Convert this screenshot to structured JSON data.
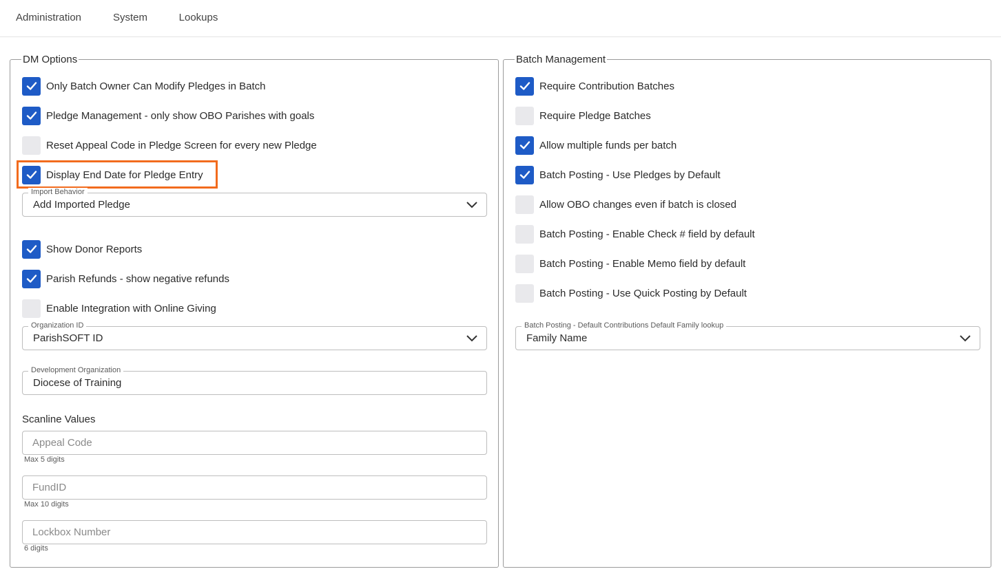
{
  "tabs": [
    {
      "label": "Administration",
      "active": true
    },
    {
      "label": "System",
      "active": false
    },
    {
      "label": "Lookups",
      "active": false
    }
  ],
  "colors": {
    "accent": "#1e5bc6",
    "highlight": "#f26b1d",
    "unchecked": "#e9e9ec"
  },
  "dm_options": {
    "legend": "DM Options",
    "checkboxes": [
      {
        "label": "Only Batch Owner Can Modify Pledges in Batch",
        "checked": true
      },
      {
        "label": "Pledge Management - only show OBO Parishes with goals",
        "checked": true
      },
      {
        "label": "Reset Appeal Code in Pledge Screen for every new Pledge",
        "checked": false
      },
      {
        "label": "Display End Date for Pledge Entry",
        "checked": true,
        "highlighted": true
      }
    ],
    "import_behavior": {
      "label": "Import Behavior",
      "value": "Add Imported Pledge"
    },
    "checkboxes2": [
      {
        "label": "Show Donor Reports",
        "checked": true
      },
      {
        "label": "Parish Refunds - show negative refunds",
        "checked": true
      },
      {
        "label": "Enable Integration with Online Giving",
        "checked": false
      }
    ],
    "organization_id": {
      "label": "Organization ID",
      "value": "ParishSOFT ID"
    },
    "development_org": {
      "label": "Development Organization",
      "value": "Diocese of Training"
    },
    "scanline": {
      "title": "Scanline Values",
      "appeal_code": {
        "placeholder": "Appeal Code",
        "helper": "Max 5 digits"
      },
      "fund_id": {
        "placeholder": "FundID",
        "helper": "Max 10 digits"
      },
      "lockbox": {
        "placeholder": "Lockbox Number",
        "helper": "6 digits"
      }
    }
  },
  "batch_management": {
    "legend": "Batch Management",
    "checkboxes": [
      {
        "label": "Require Contribution Batches",
        "checked": true
      },
      {
        "label": "Require Pledge Batches",
        "checked": false
      },
      {
        "label": "Allow multiple funds per batch",
        "checked": true
      },
      {
        "label": "Batch Posting - Use Pledges by Default",
        "checked": true
      },
      {
        "label": "Allow OBO changes even if batch is closed",
        "checked": false
      },
      {
        "label": "Batch Posting - Enable Check # field by default",
        "checked": false
      },
      {
        "label": "Batch Posting - Enable Memo field by default",
        "checked": false
      },
      {
        "label": "Batch Posting - Use Quick Posting by Default",
        "checked": false
      }
    ],
    "family_lookup": {
      "label": "Batch Posting - Default Contributions Default Family lookup",
      "value": "Family Name"
    }
  }
}
